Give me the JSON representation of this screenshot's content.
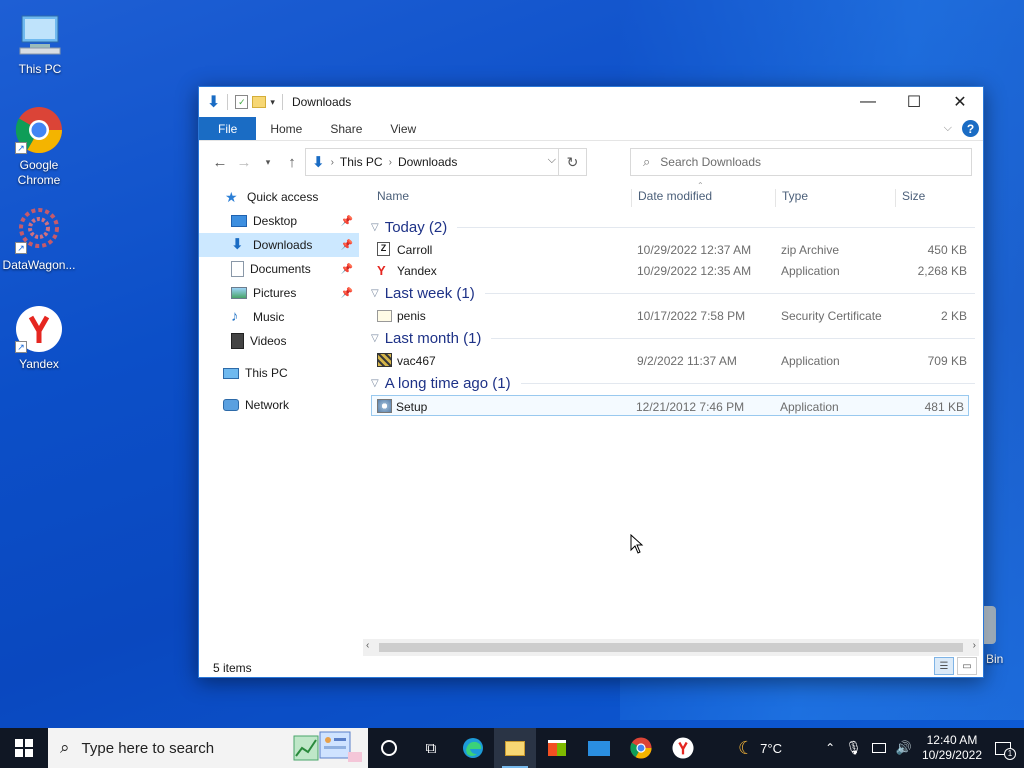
{
  "desktop": {
    "icons": [
      {
        "label": "This PC"
      },
      {
        "label": "Google Chrome"
      },
      {
        "label": "DataWagon..."
      },
      {
        "label": "Yandex"
      }
    ],
    "recycle_fragment": "Bin"
  },
  "window": {
    "title": "Downloads",
    "ribbon": {
      "file": "File",
      "home": "Home",
      "share": "Share",
      "view": "View"
    },
    "address": {
      "crumbs": [
        "This PC",
        "Downloads"
      ]
    },
    "search_placeholder": "Search Downloads",
    "sidebar": {
      "quick_access": "Quick access",
      "items": [
        "Desktop",
        "Downloads",
        "Documents",
        "Pictures",
        "Music",
        "Videos"
      ],
      "this_pc": "This PC",
      "network": "Network"
    },
    "columns": {
      "name": "Name",
      "date": "Date modified",
      "type": "Type",
      "size": "Size"
    },
    "groups": [
      {
        "label": "Today (2)",
        "files": [
          {
            "name": "Carroll",
            "date": "10/29/2022 12:37 AM",
            "type": "zip Archive",
            "size": "450 KB",
            "icon": "zip-icon"
          },
          {
            "name": "Yandex",
            "date": "10/29/2022 12:35 AM",
            "type": "Application",
            "size": "2,268 KB",
            "icon": "yandex-icon"
          }
        ]
      },
      {
        "label": "Last week (1)",
        "files": [
          {
            "name": "penis",
            "date": "10/17/2022 7:58 PM",
            "type": "Security Certificate",
            "size": "2 KB",
            "icon": "certificate-icon"
          }
        ]
      },
      {
        "label": "Last month (1)",
        "files": [
          {
            "name": "vac467",
            "date": "9/2/2022 11:37 AM",
            "type": "Application",
            "size": "709 KB",
            "icon": "application-icon"
          }
        ]
      },
      {
        "label": "A long time ago (1)",
        "files": [
          {
            "name": "Setup",
            "date": "12/21/2012 7:46 PM",
            "type": "Application",
            "size": "481 KB",
            "icon": "setup-icon"
          }
        ]
      }
    ],
    "status": "5 items"
  },
  "taskbar": {
    "search_placeholder": "Type here to search",
    "weather": "7°C",
    "time": "12:40 AM",
    "date": "10/29/2022",
    "notifications": "1"
  },
  "colors": {
    "accent": "#1a6cc4",
    "selection": "#cce8ff",
    "group_text": "#1e3287"
  }
}
